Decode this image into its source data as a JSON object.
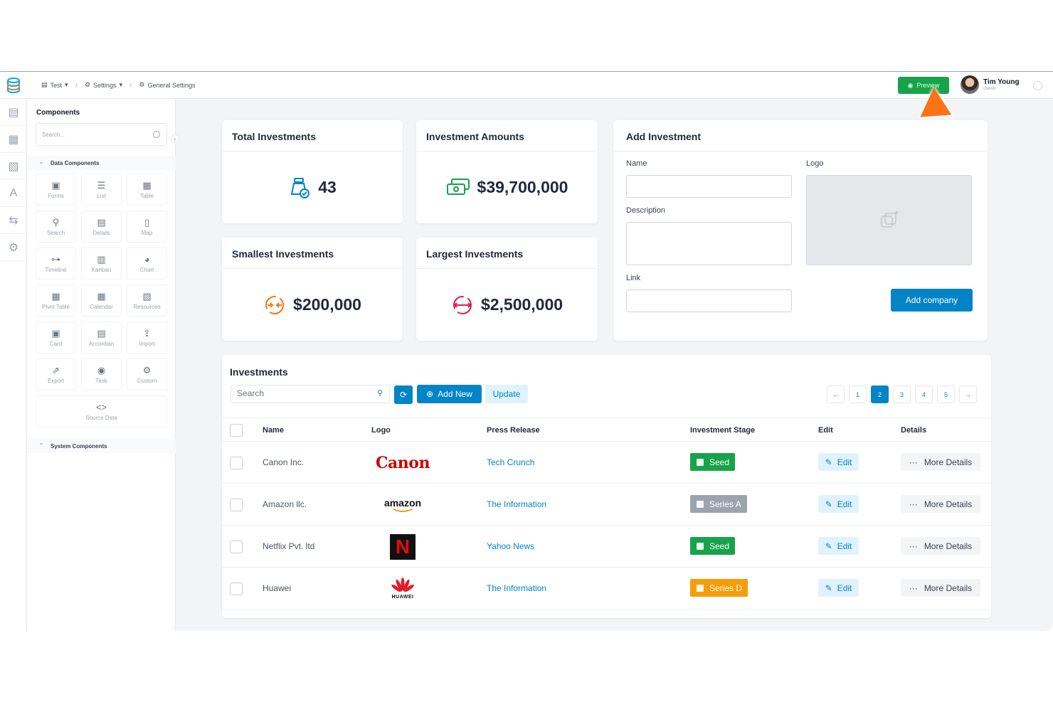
{
  "topbar": {
    "breadcrumbs": [
      "Test",
      "Settings",
      "General Settings"
    ],
    "preview_label": "Preview",
    "user": {
      "name": "Tim Young",
      "role": "Owner"
    }
  },
  "sidebar": {
    "title": "Components",
    "search_placeholder": "Search...",
    "data_group": "Data Components",
    "system_group": "System Components",
    "tiles": [
      {
        "label": "Forms",
        "icon": "forms-icon",
        "glyph": "▣"
      },
      {
        "label": "List",
        "icon": "list-icon",
        "glyph": "☰"
      },
      {
        "label": "Table",
        "icon": "table-icon",
        "glyph": "▦"
      },
      {
        "label": "Search",
        "icon": "search-icon",
        "glyph": "⚲"
      },
      {
        "label": "Details",
        "icon": "details-icon",
        "glyph": "▤"
      },
      {
        "label": "Map",
        "icon": "map-icon",
        "glyph": "▯"
      },
      {
        "label": "Timeline",
        "icon": "timeline-icon",
        "glyph": "⊶"
      },
      {
        "label": "Kanban",
        "icon": "kanban-icon",
        "glyph": "▥"
      },
      {
        "label": "Chart",
        "icon": "chart-icon",
        "glyph": "◕"
      },
      {
        "label": "Pivot Table",
        "icon": "pivot-table-icon",
        "glyph": "▦"
      },
      {
        "label": "Calendar",
        "icon": "calendar-icon",
        "glyph": "▦"
      },
      {
        "label": "Resources",
        "icon": "resources-icon",
        "glyph": "▧"
      },
      {
        "label": "Card",
        "icon": "card-icon",
        "glyph": "▣"
      },
      {
        "label": "Accordian",
        "icon": "accordian-icon",
        "glyph": "▤"
      },
      {
        "label": "Import",
        "icon": "import-icon",
        "glyph": "⇪"
      },
      {
        "label": "Export",
        "icon": "export-icon",
        "glyph": "⇗"
      },
      {
        "label": "Task",
        "icon": "task-icon",
        "glyph": "◉"
      },
      {
        "label": "Custom",
        "icon": "custom-icon",
        "glyph": "⚙"
      }
    ],
    "source_data": "Source Data"
  },
  "stats": [
    {
      "title": "Total Investments",
      "value": "43",
      "color": "#0284c7"
    },
    {
      "title": "Investment Amounts",
      "value": "$39,700,000",
      "color": "#16a34a"
    },
    {
      "title": "Smallest Investments",
      "value": "$200,000",
      "color": "#f97316"
    },
    {
      "title": "Largest Investments",
      "value": "$2,500,000",
      "color": "#e11d48"
    }
  ],
  "add_investment": {
    "title": "Add Investment",
    "name_label": "Name",
    "logo_label": "Logo",
    "description_label": "Description",
    "link_label": "Link",
    "submit_label": "Add company"
  },
  "investments": {
    "title": "Investments",
    "search_placeholder": "Search",
    "add_new_label": "Add New",
    "update_label": "Update",
    "pages": [
      "←",
      "1",
      "2",
      "3",
      "4",
      "5",
      "→"
    ],
    "active_page": "2",
    "columns": [
      "Name",
      "Logo",
      "Press Release",
      "Investment Stage",
      "Edit",
      "Details"
    ],
    "rows": [
      {
        "name": "Canon Inc.",
        "logo": "Canon",
        "press": "Tech Crunch",
        "stage": "Seed",
        "stage_color": "#16a34a"
      },
      {
        "name": "Amazon llc.",
        "logo": "amazon",
        "press": "The Information",
        "stage": "Series A",
        "stage_color": "#9ca3af"
      },
      {
        "name": "Netflix Pvt. ltd",
        "logo": "N",
        "press": "Yahoo News",
        "stage": "Seed",
        "stage_color": "#16a34a"
      },
      {
        "name": "Huawei",
        "logo": "HUAWEI",
        "press": "The Information",
        "stage": "Series D",
        "stage_color": "#f59e0b"
      }
    ],
    "edit_label": "Edit",
    "details_label": "More Details"
  }
}
